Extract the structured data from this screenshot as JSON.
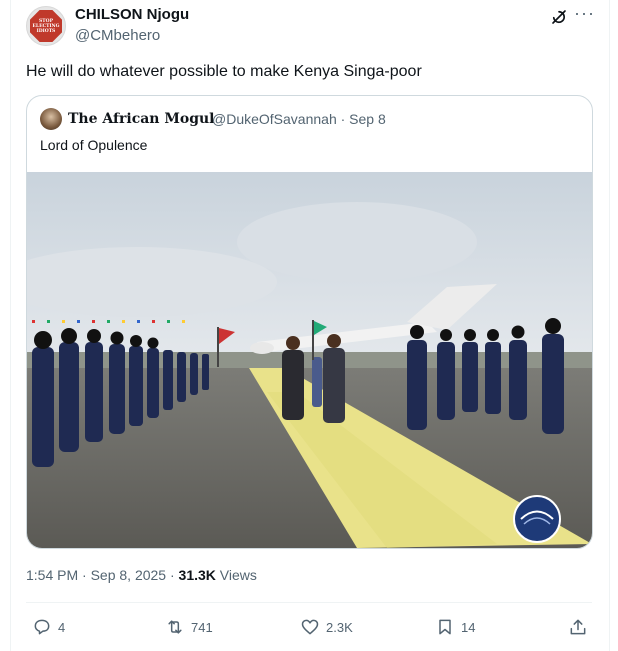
{
  "author": {
    "display_name": "CHILSON Njogu",
    "handle": "@CMbehero",
    "avatar_text": [
      "STOP",
      "ELECTING",
      "IDIOTS"
    ]
  },
  "tweet": {
    "text": "He will do whatever possible to make Kenya Singa-poor"
  },
  "quoted": {
    "display_name": "The African Mogul",
    "handle_and_date": "@DukeOfSavannah · Sep 8",
    "text": "Lord of Opulence"
  },
  "meta": {
    "time_date": "1:54 PM · Sep 8, 2025 · ",
    "views_count": "31.3K",
    "views_label": " Views"
  },
  "actions": {
    "replies": "4",
    "reposts": "741",
    "likes": "2.3K",
    "bookmarks": "14"
  },
  "colors": {
    "text": "#0f1419",
    "secondary": "#536471",
    "border": "#cfd9de",
    "carpet": "#e9e28a",
    "uniform": "#1f2a52"
  },
  "icons": [
    "grok-icon",
    "more-icon",
    "reply-icon",
    "repost-icon",
    "like-icon",
    "bookmark-icon",
    "share-icon"
  ]
}
